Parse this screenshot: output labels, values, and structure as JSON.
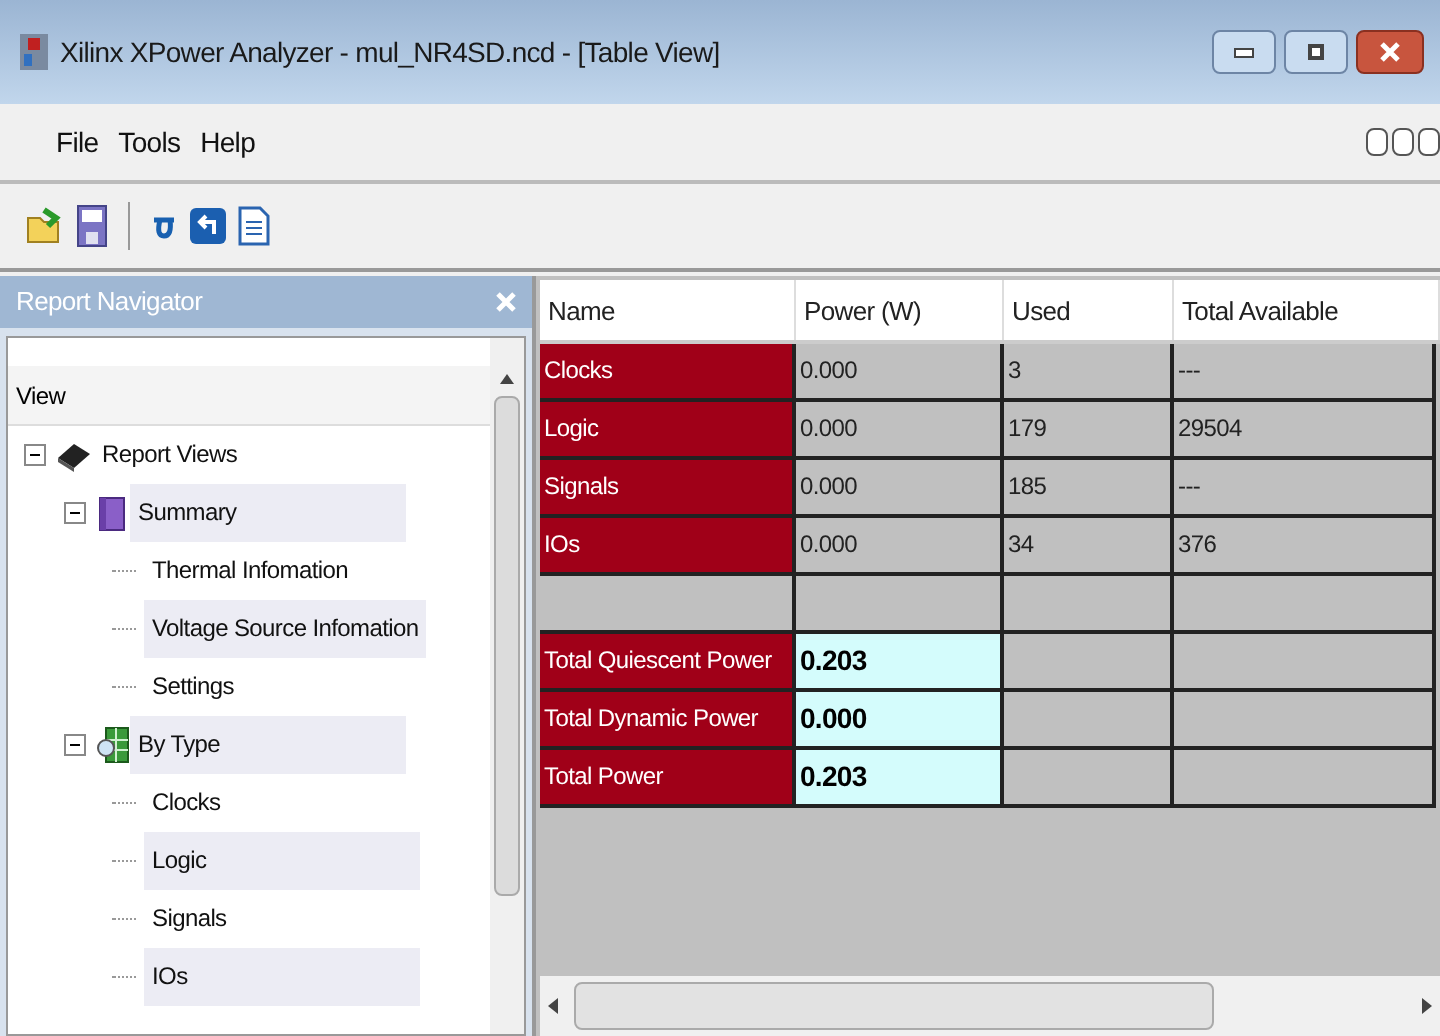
{
  "window": {
    "title": "Xilinx XPower Analyzer - mul_NR4SD.ncd - [Table View]"
  },
  "menu": [
    "File",
    "Tools",
    "Help"
  ],
  "navigator": {
    "title": "Report Navigator",
    "column": "View",
    "tree": [
      {
        "label": "Report Views",
        "shaded": false,
        "expanded": true,
        "kind": "chip",
        "children": [
          {
            "label": "Summary",
            "shaded": true,
            "expanded": true,
            "kind": "book",
            "children": [
              {
                "label": "Thermal Infomation",
                "shaded": false
              },
              {
                "label": "Voltage Source Infomation",
                "shaded": true
              },
              {
                "label": "Settings",
                "shaded": false
              }
            ]
          },
          {
            "label": "By Type",
            "shaded": true,
            "expanded": true,
            "kind": "grid",
            "children": [
              {
                "label": "Clocks",
                "shaded": false
              },
              {
                "label": "Logic",
                "shaded": true
              },
              {
                "label": "Signals",
                "shaded": false
              },
              {
                "label": "IOs",
                "shaded": true
              }
            ]
          }
        ]
      }
    ]
  },
  "table": {
    "columns": [
      "Name",
      "Power (W)",
      "Used",
      "Total Available"
    ],
    "rows": [
      {
        "kind": "item",
        "cells": [
          "Clocks",
          "0.000",
          "3",
          "---"
        ]
      },
      {
        "kind": "item",
        "cells": [
          "Logic",
          "0.000",
          "179",
          "29504"
        ]
      },
      {
        "kind": "item",
        "cells": [
          "Signals",
          "0.000",
          "185",
          "---"
        ]
      },
      {
        "kind": "item",
        "cells": [
          "IOs",
          "0.000",
          "34",
          "376"
        ]
      },
      {
        "kind": "blank",
        "cells": []
      },
      {
        "kind": "total",
        "cells": [
          "Total Quiescent Power",
          "0.203"
        ]
      },
      {
        "kind": "total",
        "cells": [
          "Total Dynamic Power",
          "0.000"
        ]
      },
      {
        "kind": "total",
        "cells": [
          "Total Power",
          "0.203"
        ]
      }
    ]
  }
}
